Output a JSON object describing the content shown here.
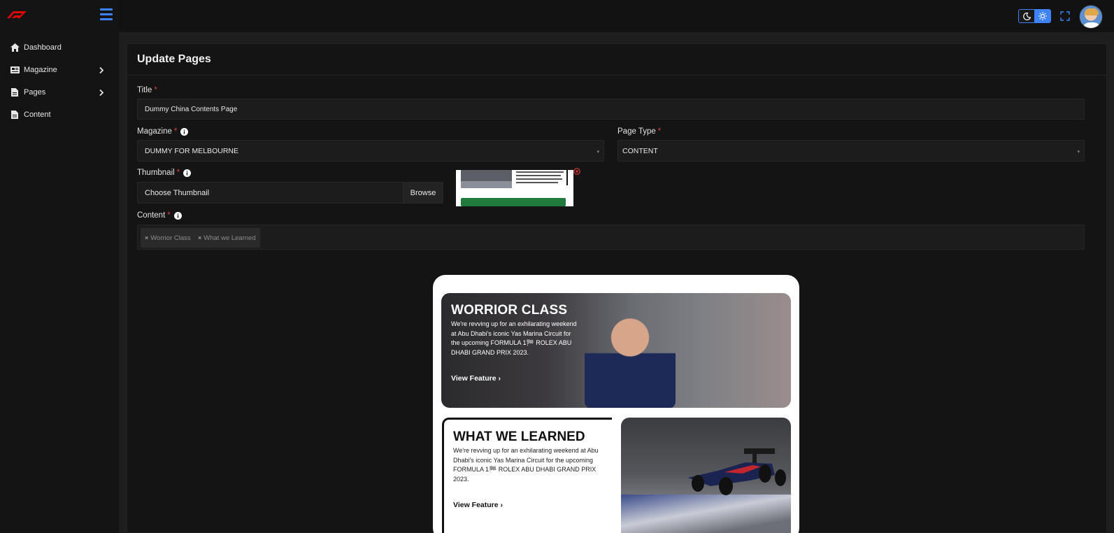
{
  "sidebar": {
    "items": [
      {
        "label": "Dashboard",
        "icon": "home-icon"
      },
      {
        "label": "Magazine",
        "icon": "newspaper-icon"
      },
      {
        "label": "Pages",
        "icon": "file-icon"
      },
      {
        "label": "Content",
        "icon": "file-icon"
      }
    ]
  },
  "header": {
    "toggle_icons": [
      "moon-icon",
      "sun-icon"
    ],
    "accent": "#3e82f7"
  },
  "page": {
    "title": "Update Pages"
  },
  "form": {
    "title_label": "Title",
    "title_value": "Dummy China Contents Page",
    "magazine_label": "Magazine",
    "magazine_value": "DUMMY FOR MELBOURNE",
    "page_type_label": "Page Type",
    "page_type_value": "CONTENT",
    "thumbnail_label": "Thumbnail",
    "thumbnail_placeholder": "Choose Thumbnail",
    "browse_label": "Browse",
    "content_label": "Content",
    "required_mark": "*",
    "tags": [
      {
        "remove": "×",
        "label": "Worrior Class"
      },
      {
        "remove": "×",
        "label": "What we Learned"
      }
    ]
  },
  "preview": {
    "feature1": {
      "title": "WORRIOR CLASS",
      "desc": "We're revving up for an exhilarating weekend at Abu Dhabi's iconic Yas Marina Circuit for the upcoming FORMULA 1🏁 ROLEX ABU DHABI GRAND PRIX 2023.",
      "link": "View Feature ›"
    },
    "feature2": {
      "title": "WHAT WE LEARNED",
      "desc": "We're revving up for an exhilarating weekend at Abu Dhabi's iconic Yas Marina Circuit for the upcoming FORMULA 1🏁 ROLEX ABU DHABI GRAND PRIX 2023.",
      "link": "View Feature ›"
    }
  }
}
